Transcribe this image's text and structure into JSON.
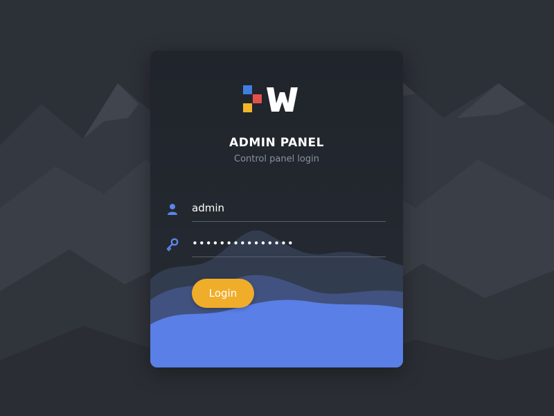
{
  "header": {
    "title": "ADMIN PANEL",
    "subtitle": "Control panel login"
  },
  "form": {
    "username_value": "admin",
    "password_value": "•••••••••••••••",
    "login_label": "Login"
  },
  "icons": {
    "logo": "w-logo-with-color-squares",
    "username": "user-icon",
    "password": "key-icon"
  },
  "colors": {
    "accent_button": "#f0ad2a",
    "wave_blue": "#5a7fe6",
    "card_bg": "#21252c",
    "page_bg": "#2a2e35",
    "logo_blue": "#3f7fe0",
    "logo_red": "#e2524a",
    "logo_yellow": "#f2b52a",
    "icon_blue": "#5b85e8"
  }
}
